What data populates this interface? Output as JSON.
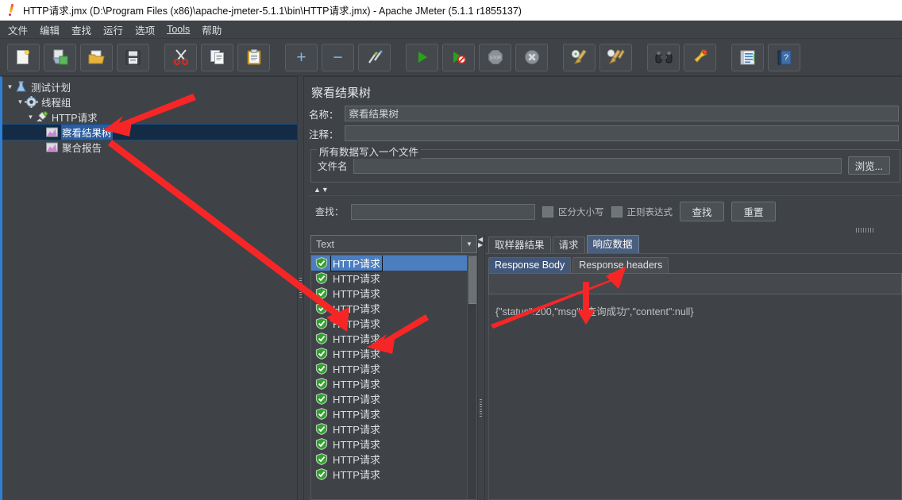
{
  "window": {
    "title": "HTTP请求.jmx (D:\\Program Files (x86)\\apache-jmeter-5.1.1\\bin\\HTTP请求.jmx) - Apache JMeter (5.1.1 r1855137)",
    "app_icon": "jmeter-feather-icon",
    "accent_color": "#2f7fd4",
    "background_color": "#3f4347",
    "selection_color": "#2b5c9e"
  },
  "menubar": {
    "items": [
      {
        "label": "文件",
        "name": "menu-file"
      },
      {
        "label": "编辑",
        "name": "menu-edit"
      },
      {
        "label": "查找",
        "name": "menu-search"
      },
      {
        "label": "运行",
        "name": "menu-run"
      },
      {
        "label": "选项",
        "name": "menu-options"
      },
      {
        "label": "Tools",
        "name": "menu-tools"
      },
      {
        "label": "帮助",
        "name": "menu-help"
      }
    ]
  },
  "toolbar": {
    "buttons": [
      {
        "icon": "new-document-icon",
        "name": "toolbar-new"
      },
      {
        "icon": "templates-icon",
        "name": "toolbar-templates"
      },
      {
        "icon": "open-folder-icon",
        "name": "toolbar-open"
      },
      {
        "icon": "save-floppy-icon",
        "name": "toolbar-save"
      },
      {
        "icon": "scissors-cut-icon",
        "name": "toolbar-cut"
      },
      {
        "icon": "copy-pages-icon",
        "name": "toolbar-copy"
      },
      {
        "icon": "clipboard-paste-icon",
        "name": "toolbar-paste"
      },
      {
        "icon": "plus-icon",
        "name": "toolbar-expand-all"
      },
      {
        "icon": "minus-icon",
        "name": "toolbar-collapse-all"
      },
      {
        "icon": "toggle-pencil-icon",
        "name": "toolbar-toggle"
      },
      {
        "icon": "play-green-icon",
        "name": "toolbar-start"
      },
      {
        "icon": "play-no-timers-icon",
        "name": "toolbar-start-no-pauses"
      },
      {
        "icon": "stop-sign-icon",
        "name": "toolbar-stop"
      },
      {
        "icon": "shutdown-x-icon",
        "name": "toolbar-shutdown"
      },
      {
        "icon": "clear-broom-icon",
        "name": "toolbar-clear"
      },
      {
        "icon": "clear-all-broom-icon",
        "name": "toolbar-clear-all"
      },
      {
        "icon": "binoculars-search-icon",
        "name": "toolbar-search"
      },
      {
        "icon": "reset-search-bell-icon",
        "name": "toolbar-reset-search"
      },
      {
        "icon": "function-helper-icon",
        "name": "toolbar-function-helper"
      },
      {
        "icon": "help-book-icon",
        "name": "toolbar-help"
      }
    ]
  },
  "tree": {
    "nodes": [
      {
        "label": "测试计划",
        "icon": "test-plan-icon",
        "indent": 0,
        "expanded": true,
        "selected": false,
        "name": "tree-node-test-plan"
      },
      {
        "label": "线程组",
        "icon": "thread-group-gear-icon",
        "indent": 1,
        "expanded": true,
        "selected": false,
        "name": "tree-node-thread-group"
      },
      {
        "label": "HTTP请求",
        "icon": "http-request-icon",
        "indent": 2,
        "expanded": true,
        "selected": false,
        "name": "tree-node-http-request"
      },
      {
        "label": "察看结果树",
        "icon": "view-results-tree-icon",
        "indent": 3,
        "expanded": false,
        "selected": true,
        "name": "tree-node-view-results-tree"
      },
      {
        "label": "聚合报告",
        "icon": "aggregate-report-icon",
        "indent": 3,
        "expanded": false,
        "selected": false,
        "name": "tree-node-aggregate-report"
      }
    ]
  },
  "panel": {
    "title": "察看结果树",
    "name_label": "名称：",
    "name_value": "察看结果树",
    "comment_label": "注释：",
    "comment_value": "",
    "file_group_title": "所有数据写入一个文件",
    "filename_label": "文件名",
    "filename_value": "",
    "browse_button": "浏览..."
  },
  "search": {
    "label": "查找：",
    "value": "",
    "case_sensitive_label": "区分大小写",
    "case_sensitive_checked": false,
    "regex_label": "正则表达式",
    "regex_checked": false,
    "find_button": "查找",
    "reset_button": "重置"
  },
  "results": {
    "renderer_selected": "Text",
    "rows": [
      {
        "label": "HTTP请求",
        "status": "success",
        "selected": true
      },
      {
        "label": "HTTP请求",
        "status": "success",
        "selected": false
      },
      {
        "label": "HTTP请求",
        "status": "success",
        "selected": false
      },
      {
        "label": "HTTP请求",
        "status": "success",
        "selected": false
      },
      {
        "label": "HTTP请求",
        "status": "success",
        "selected": false
      },
      {
        "label": "HTTP请求",
        "status": "success",
        "selected": false
      },
      {
        "label": "HTTP请求",
        "status": "success",
        "selected": false
      },
      {
        "label": "HTTP请求",
        "status": "success",
        "selected": false
      },
      {
        "label": "HTTP请求",
        "status": "success",
        "selected": false
      },
      {
        "label": "HTTP请求",
        "status": "success",
        "selected": false
      },
      {
        "label": "HTTP请求",
        "status": "success",
        "selected": false
      },
      {
        "label": "HTTP请求",
        "status": "success",
        "selected": false
      },
      {
        "label": "HTTP请求",
        "status": "success",
        "selected": false
      },
      {
        "label": "HTTP请求",
        "status": "success",
        "selected": false
      },
      {
        "label": "HTTP请求",
        "status": "success",
        "selected": false
      }
    ]
  },
  "detail": {
    "tabs": [
      {
        "label": "取样器结果",
        "active": false,
        "name": "tab-sampler-result"
      },
      {
        "label": "请求",
        "active": false,
        "name": "tab-request"
      },
      {
        "label": "响应数据",
        "active": true,
        "name": "tab-response-data"
      }
    ],
    "subtabs": [
      {
        "label": "Response Body",
        "active": true,
        "name": "subtab-response-body"
      },
      {
        "label": "Response headers",
        "active": false,
        "name": "subtab-response-headers"
      }
    ],
    "body_search_value": "",
    "body_text": "{\"status\":200,\"msg\":\"查询成功\",\"content\":null}"
  },
  "annotations": {
    "arrow_color": "#f72626",
    "arrows": [
      {
        "name": "arrow-to-view-results-tree",
        "points": "to 察看结果树 tree node"
      },
      {
        "name": "arrow-to-results-list",
        "points": "to HTTP请求 result rows"
      },
      {
        "name": "arrow-to-response-data-tab",
        "points": "to 响应数据 tab"
      },
      {
        "name": "arrow-to-response-body",
        "points": "to Response Body content"
      }
    ]
  }
}
